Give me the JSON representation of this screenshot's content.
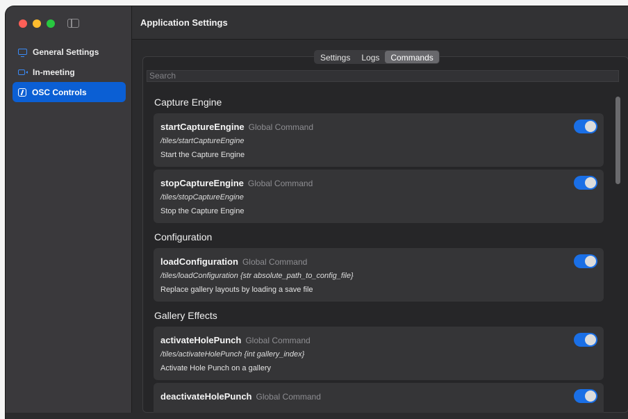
{
  "sidebar": {
    "items": [
      {
        "label": "General Settings",
        "icon": "monitor-icon"
      },
      {
        "label": "In-meeting",
        "icon": "camera-icon"
      },
      {
        "label": "OSC Controls",
        "icon": "slash-icon",
        "active": true
      }
    ]
  },
  "header": {
    "title": "Application Settings"
  },
  "tabs": [
    {
      "label": "Settings"
    },
    {
      "label": "Logs"
    },
    {
      "label": "Commands",
      "active": true
    }
  ],
  "search": {
    "placeholder": "Search"
  },
  "sections": [
    {
      "title": "Capture Engine",
      "commands": [
        {
          "name": "startCaptureEngine",
          "scope": "Global Command",
          "path": "/tiles/startCaptureEngine",
          "description": "Start the Capture Engine",
          "enabled": true
        },
        {
          "name": "stopCaptureEngine",
          "scope": "Global Command",
          "path": "/tiles/stopCaptureEngine",
          "description": "Stop the Capture Engine",
          "enabled": true
        }
      ]
    },
    {
      "title": "Configuration",
      "commands": [
        {
          "name": "loadConfiguration",
          "scope": "Global Command",
          "path": "/tiles/loadConfiguration {str absolute_path_to_config_file}",
          "description": "Replace gallery layouts by loading a save file",
          "enabled": true
        }
      ]
    },
    {
      "title": "Gallery Effects",
      "commands": [
        {
          "name": "activateHolePunch",
          "scope": "Global Command",
          "path": "/tiles/activateHolePunch {int gallery_index}",
          "description": "Activate Hole Punch on a gallery",
          "enabled": true
        },
        {
          "name": "deactivateHolePunch",
          "scope": "Global Command",
          "path": "",
          "description": "",
          "enabled": true
        }
      ]
    }
  ],
  "colors": {
    "accent": "#0b5fd4",
    "toggle_on": "#1a6fe6"
  }
}
